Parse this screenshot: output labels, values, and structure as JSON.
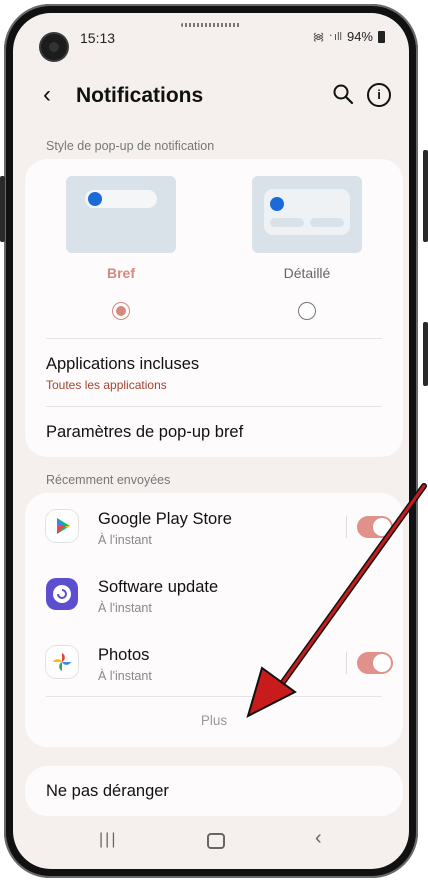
{
  "status_bar": {
    "time": "15:13",
    "battery": "94%",
    "signal_icons": "᯼ ᛫ıll"
  },
  "header": {
    "title": "Notifications",
    "back_icon": "chevron-left",
    "search_icon": "search",
    "info_icon": "info"
  },
  "popup_style": {
    "section_label": "Style de pop-up de notification",
    "options": [
      {
        "label": "Bref",
        "selected": true,
        "color": "#d58a80"
      },
      {
        "label": "Détaillé",
        "selected": false,
        "color": "#666666"
      }
    ]
  },
  "settings": {
    "included_apps": {
      "title": "Applications incluses",
      "subtitle": "Toutes les applications"
    },
    "brief_params": {
      "title": "Paramètres de pop-up bref"
    }
  },
  "recent": {
    "section_label": "Récemment envoyées",
    "apps": [
      {
        "name": "Google Play Store",
        "time": "À l'instant",
        "toggle": true
      },
      {
        "name": "Software update",
        "time": "À l'instant",
        "toggle": null
      },
      {
        "name": "Photos",
        "time": "À l'instant",
        "toggle": true
      }
    ],
    "more_label": "Plus"
  },
  "dnd": {
    "title": "Ne pas déranger"
  },
  "accent_color": "#e0918a"
}
